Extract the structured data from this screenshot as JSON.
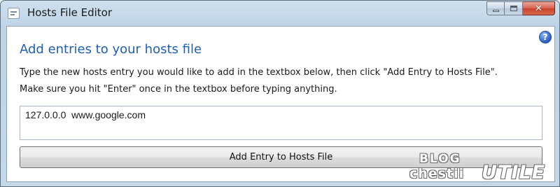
{
  "window": {
    "title": "Hosts File Editor",
    "icon": "hosts-editor-app-icon",
    "controls": {
      "minimize": "minimize-icon",
      "maximize": "maximize-icon",
      "close_glyph": "✕"
    }
  },
  "help": {
    "glyph": "?",
    "icon": "help-icon"
  },
  "main": {
    "heading": "Add entries to your hosts file",
    "instruction_line1": "Type the new hosts entry you would like to add in the textbox below, then click \"Add Entry to Hosts File\".",
    "instruction_line2": "Make sure you hit \"Enter\" once in the textbox before typing anything.",
    "entry_value": "127.0.0.0  www.google.com",
    "add_button_label": "Add Entry to Hosts File"
  },
  "watermark": {
    "line1": "BLOG",
    "line2": "chestii",
    "line3": "UTILE"
  },
  "colors": {
    "heading": "#1e5fb2",
    "close_button": "#c7402a",
    "title_bar": "#bdd3e6",
    "help_icon": "#2a5fc4"
  }
}
